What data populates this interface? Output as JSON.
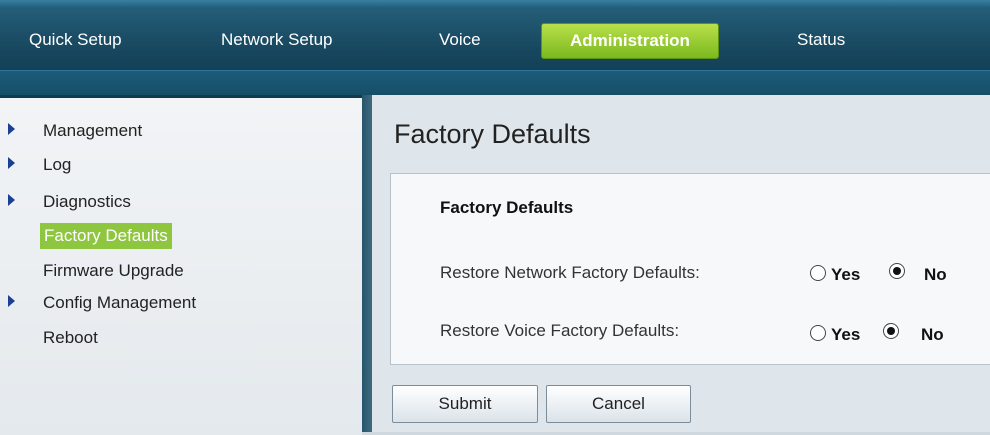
{
  "nav": {
    "tabs": [
      {
        "label": "Quick Setup"
      },
      {
        "label": "Network Setup"
      },
      {
        "label": "Voice"
      },
      {
        "label": "Administration",
        "active": true
      },
      {
        "label": "Status"
      }
    ]
  },
  "sidebar": {
    "items": [
      {
        "label": "Management",
        "has_arrow": true
      },
      {
        "label": "Log",
        "has_arrow": true
      },
      {
        "label": "Diagnostics",
        "has_arrow": true
      },
      {
        "label": "Factory Defaults",
        "active": true
      },
      {
        "label": "Firmware Upgrade"
      },
      {
        "label": "Config Management",
        "has_arrow": true
      },
      {
        "label": "Reboot"
      }
    ]
  },
  "main": {
    "page_title": "Factory Defaults",
    "section_title": "Factory Defaults",
    "rows": [
      {
        "label": "Restore Network Factory Defaults:",
        "yes": "Yes",
        "no": "No",
        "selected": "No"
      },
      {
        "label": "Restore Voice Factory Defaults:",
        "yes": "Yes",
        "no": "No",
        "selected": "No"
      }
    ],
    "buttons": {
      "submit": "Submit",
      "cancel": "Cancel"
    }
  },
  "colors": {
    "nav_bg": "#16465d",
    "active_tab": "#8ec63f",
    "sidebar_arrow": "#1a3f93"
  }
}
